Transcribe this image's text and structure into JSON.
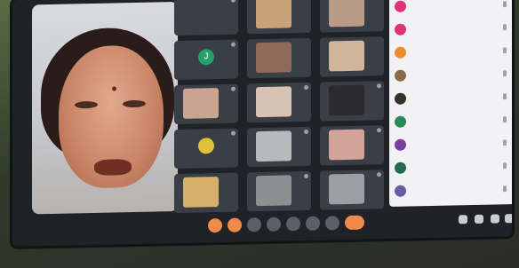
{
  "meeting": {
    "time": "",
    "meeting_code": ""
  },
  "speaker": {
    "label": ""
  },
  "grid_tiles": [
    {
      "caption": "",
      "avatar_letter": "",
      "kind": "blank"
    },
    {
      "caption": "",
      "avatar_letter": "",
      "kind": "photo",
      "color": "#c9a27a"
    },
    {
      "caption": "",
      "avatar_letter": "",
      "kind": "photo",
      "color": "#b99a86"
    },
    {
      "caption": "",
      "avatar_letter": "J",
      "kind": "avatar",
      "color": "#26a269"
    },
    {
      "caption": "",
      "avatar_letter": "",
      "kind": "photo",
      "color": "#8e6a5a"
    },
    {
      "caption": "",
      "avatar_letter": "",
      "kind": "photo",
      "color": "#d2b49a"
    },
    {
      "caption": "",
      "avatar_letter": "",
      "kind": "photo",
      "color": "#caa48e"
    },
    {
      "caption": "",
      "avatar_letter": "",
      "kind": "photo",
      "color": "#d8c2b4"
    },
    {
      "caption": "",
      "avatar_letter": "",
      "kind": "photo",
      "color": "#2b2b2e"
    },
    {
      "caption": "",
      "avatar_letter": "",
      "kind": "avatar",
      "color": "#e0c23a"
    },
    {
      "caption": "",
      "avatar_letter": "",
      "kind": "photo",
      "color": "#b7b9bd"
    },
    {
      "caption": "",
      "avatar_letter": "",
      "kind": "photo",
      "color": "#d3a39a"
    },
    {
      "caption": "",
      "avatar_letter": "",
      "kind": "photo",
      "color": "#d5b06d"
    },
    {
      "caption": "",
      "avatar_letter": "",
      "kind": "photo",
      "color": "#8d8f93"
    },
    {
      "caption": "",
      "avatar_letter": "",
      "kind": "photo",
      "color": "#9c9ea3"
    }
  ],
  "participants": [
    {
      "name": "",
      "color": "#e2327a"
    },
    {
      "name": "",
      "color": "#e2327a"
    },
    {
      "name": "",
      "color": "#f08a2c"
    },
    {
      "name": "",
      "color": "#8a6b4d"
    },
    {
      "name": "",
      "color": "#3a2f28"
    },
    {
      "name": "",
      "color": "#2e8b57"
    },
    {
      "name": "",
      "color": "#7a3fa0"
    },
    {
      "name": "",
      "color": "#1f6b4a"
    },
    {
      "name": "",
      "color": "#6a5aa8"
    }
  ],
  "controls": [
    "mic",
    "camera",
    "captions",
    "emoji",
    "present",
    "raise-hand",
    "more",
    "end-call"
  ],
  "colors": {
    "accent": "#f08a4b",
    "panel_bg": "#f2f2f5",
    "tile_bg": "#3a3e47"
  }
}
